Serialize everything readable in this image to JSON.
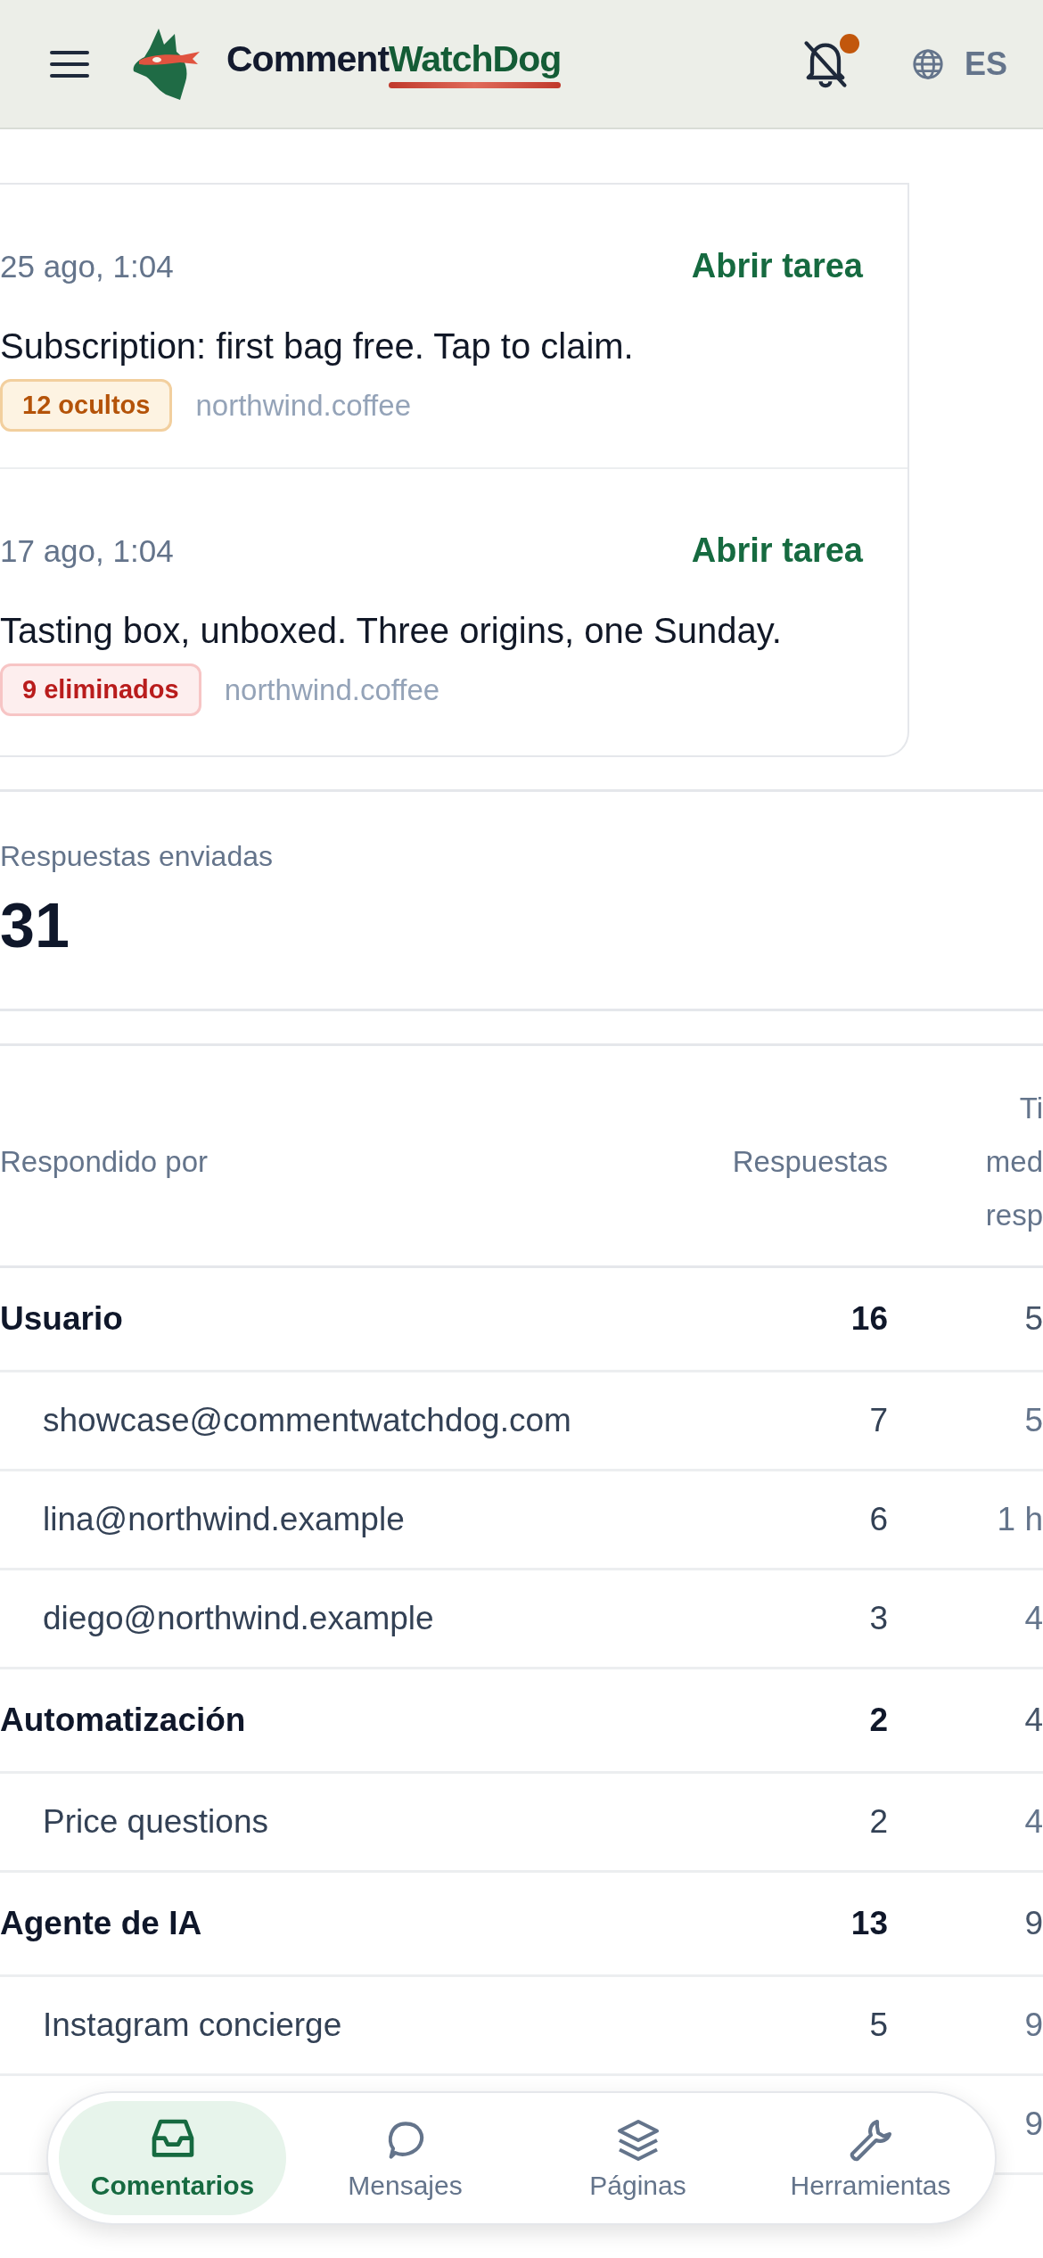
{
  "header": {
    "brand_first": "Comment",
    "brand_second": "WatchDog",
    "notifications_unread": true,
    "language": "ES"
  },
  "tasks": [
    {
      "date": "25 ago, 1:04",
      "action": "Abrir tarea",
      "text": "Subscription: first bag free. Tap to claim.",
      "badge": {
        "kind": "hidden",
        "label": "12 ocultos"
      },
      "source": "northwind.coffee"
    },
    {
      "date": "17 ago, 1:04",
      "action": "Abrir tarea",
      "text": "Tasting box, unboxed. Three origins, one Sunday.",
      "badge": {
        "kind": "deleted",
        "label": "9 eliminados"
      },
      "source": "northwind.coffee"
    }
  ],
  "stat": {
    "label": "Respuestas enviadas",
    "value": "31"
  },
  "table": {
    "columns": [
      [
        "Respondido por"
      ],
      [
        "Respuestas"
      ],
      [
        "Ti",
        "med",
        "resp"
      ]
    ],
    "rows": [
      {
        "kind": "group",
        "label": "Usuario",
        "count": "16",
        "column_3": "5"
      },
      {
        "kind": "child",
        "label": "showcase@commentwatchdog.com",
        "count": "7",
        "column_3": "5"
      },
      {
        "kind": "child",
        "label": "lina@northwind.example",
        "count": "6",
        "column_3": "1 h"
      },
      {
        "kind": "child",
        "label": "diego@northwind.example",
        "count": "3",
        "column_3": "4"
      },
      {
        "kind": "group",
        "label": "Automatización",
        "count": "2",
        "column_3": "4"
      },
      {
        "kind": "child",
        "label": "Price questions",
        "count": "2",
        "column_3": "4"
      },
      {
        "kind": "group",
        "label": "Agente de IA",
        "count": "13",
        "column_3": "9"
      },
      {
        "kind": "child",
        "label": "Instagram concierge",
        "count": "5",
        "column_3": "9"
      },
      {
        "kind": "child",
        "column_3": "9"
      }
    ]
  },
  "nav": [
    {
      "label": "Comentarios",
      "selected": true
    },
    {
      "label": "Mensajes",
      "selected": false
    },
    {
      "label": "Páginas",
      "selected": false
    },
    {
      "label": "Herramientas",
      "selected": false
    }
  ]
}
